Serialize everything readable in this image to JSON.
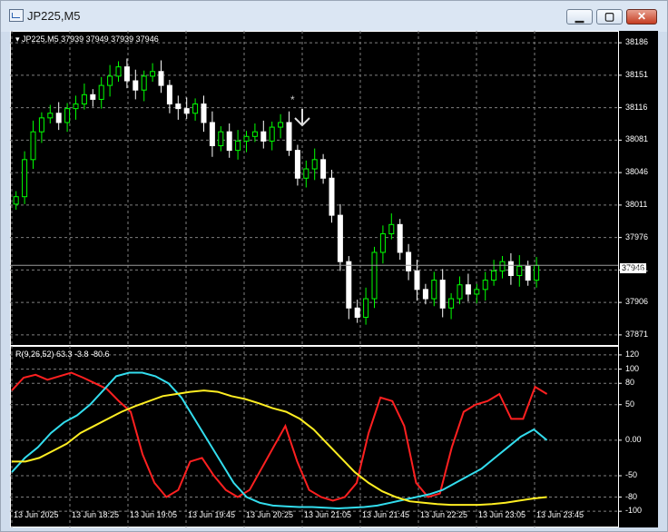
{
  "window": {
    "title": "JP225,M5",
    "buttons": {
      "minimize": "▁",
      "maximize": "▢",
      "close": "✕"
    }
  },
  "price_panel": {
    "legend_symbol": "JP225,M5",
    "legend_ohlc": "37939 37949 37939 37946",
    "y_ticks": [
      "38186",
      "38151",
      "38116",
      "38081",
      "38046",
      "38011",
      "37976",
      "37941",
      "37906",
      "37871"
    ],
    "current_price": "37946",
    "colors": {
      "bull": "#00ff00",
      "bear": "#ffffff",
      "grid": "#7f7f7f",
      "background": "#000000"
    }
  },
  "indicator_panel": {
    "legend": "R(9,26,52) 63.3 -3.8 -80.6",
    "y_ticks": [
      "120",
      "100",
      "80",
      "50",
      "0.00",
      "-50",
      "-80",
      "-100"
    ],
    "line_colors": {
      "fast": "#ff2020",
      "mid": "#33ddee",
      "slow": "#ffee22"
    }
  },
  "x_axis": {
    "labels": [
      "13 Jun 2025",
      "13 Jun 18:25",
      "13 Jun 19:05",
      "13 Jun 19:45",
      "13 Jun 20:25",
      "13 Jun 21:05",
      "13 Jun 21:45",
      "13 Jun 22:25",
      "13 Jun 23:05",
      "13 Jun 23:45"
    ]
  },
  "chart_data": [
    {
      "type": "candlestick",
      "symbol": "JP225",
      "timeframe": "M5",
      "ohlc_last": [
        37939,
        37949,
        37939,
        37946
      ],
      "ylim": [
        37866,
        38191
      ],
      "close_path": [
        38020,
        38060,
        38090,
        38105,
        38110,
        38100,
        38115,
        38120,
        38130,
        38125,
        38140,
        38150,
        38160,
        38145,
        38135,
        38150,
        38155,
        38140,
        38120,
        38115,
        38110,
        38120,
        38100,
        38075,
        38090,
        38070,
        38080,
        38085,
        38090,
        38080,
        38095,
        38100,
        38070,
        38040,
        38050,
        38060,
        38040,
        38000,
        37950,
        37900,
        37890,
        37910,
        37960,
        37980,
        37990,
        37960,
        37940,
        37920,
        37910,
        37930,
        37900,
        37910,
        37925,
        37915,
        37920,
        37930,
        37940,
        37950,
        37935,
        37945,
        37930,
        37946
      ]
    },
    {
      "type": "line",
      "name": "R(9,26,52)",
      "ylim": [
        -110,
        125
      ],
      "series": [
        {
          "name": "fast",
          "values": [
            70,
            88,
            92,
            85,
            90,
            95,
            88,
            80,
            72,
            55,
            40,
            -20,
            -60,
            -80,
            -70,
            -30,
            -25,
            -50,
            -70,
            -80,
            -70,
            -40,
            -10,
            20,
            -30,
            -70,
            -80,
            -85,
            -80,
            -60,
            10,
            60,
            55,
            20,
            -60,
            -80,
            -75,
            -10,
            40,
            50,
            55,
            65,
            30,
            30,
            75,
            65
          ]
        },
        {
          "name": "mid",
          "values": [
            -45,
            -25,
            -10,
            10,
            25,
            35,
            50,
            70,
            90,
            95,
            95,
            90,
            80,
            60,
            30,
            0,
            -30,
            -60,
            -80,
            -88,
            -92,
            -93,
            -94,
            -94,
            -95,
            -96,
            -95,
            -94,
            -92,
            -88,
            -84,
            -80,
            -76,
            -70,
            -60,
            -50,
            -40,
            -25,
            -10,
            5,
            15,
            0
          ]
        },
        {
          "name": "slow",
          "values": [
            -30,
            -30,
            -25,
            -15,
            -5,
            10,
            20,
            30,
            40,
            48,
            55,
            62,
            65,
            68,
            70,
            68,
            62,
            58,
            52,
            45,
            40,
            30,
            15,
            -5,
            -25,
            -45,
            -60,
            -72,
            -80,
            -86,
            -88,
            -90,
            -91,
            -91,
            -91,
            -90,
            -88,
            -85,
            -82,
            -80
          ]
        }
      ]
    }
  ]
}
